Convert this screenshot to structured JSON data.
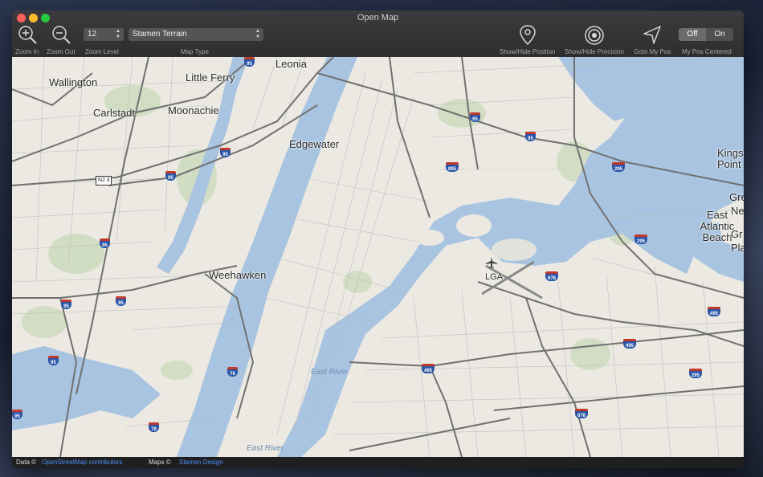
{
  "window": {
    "title": "Open Map"
  },
  "toolbar": {
    "zoom_in_label": "Zoom In",
    "zoom_out_label": "Zoom Out",
    "zoom_level_value": "12",
    "zoom_level_label": "Zoom Level",
    "map_type_value": "Stamen Terrain",
    "map_type_label": "Map Type",
    "show_position_label": "Show/Hide Position",
    "show_precision_label": "Show/Hide Precision",
    "goto_pos_label": "Goto My Pos",
    "centered_label": "My Pos Centered",
    "centered_off": "Off",
    "centered_on": "On",
    "centered_state": "Off"
  },
  "map": {
    "places": [
      "Wallington",
      "Little Ferry",
      "Leonia",
      "Carlstadt",
      "Moonachie",
      "Edgewater",
      "Weehawken",
      "Kings Point",
      "East Atlantic Beach",
      "LGA",
      "Gre",
      "Ne",
      "Gr",
      "Pla"
    ],
    "water": [
      "East River",
      "East River"
    ],
    "route_shields": [
      "95",
      "95",
      "95",
      "95",
      "95",
      "95",
      "95",
      "95",
      "95",
      "895",
      "295",
      "295",
      "295",
      "495",
      "495",
      "495",
      "678",
      "678",
      "78",
      "78",
      "95"
    ],
    "state_route": "NJ 3"
  },
  "status": {
    "data_label": "Data ©",
    "data_link": "OpenStreetMap contributors",
    "maps_label": "Maps ©",
    "maps_link": "Stamen Design"
  },
  "colors": {
    "water": "#a9c4e0",
    "land": "#ebe9e2",
    "park": "#cfdcc0",
    "road": "#6e6e6e"
  }
}
